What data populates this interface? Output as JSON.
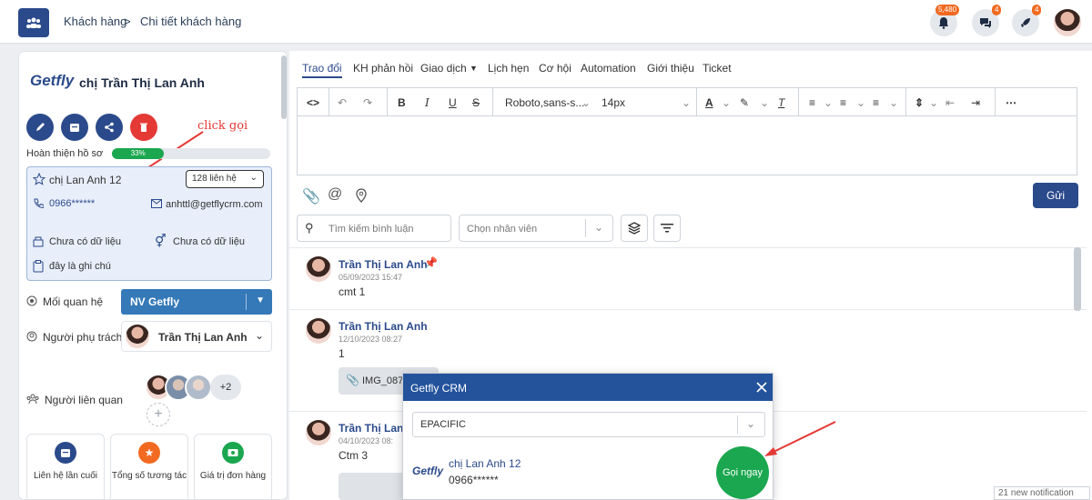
{
  "topbar": {
    "breadcrumb_1": "Khách hàng",
    "breadcrumb_sep": ">",
    "breadcrumb_2": "Chi tiết khách hàng",
    "notif_count": "5,480",
    "chat_count": "4",
    "rocket_count": "4"
  },
  "customer": {
    "logo": "Getfly",
    "name": "chị Trần Thị Lan Anh",
    "progress_label": "Hoàn thiện hồ sơ",
    "progress_value": "33%",
    "progress_fraction": 0.33
  },
  "annotations": {
    "click_call": "click gọi"
  },
  "contact": {
    "name": "chị Lan Anh 12",
    "count_label": "128 liên hệ",
    "phone": "0966******",
    "email": "anhttl@getflycrm.com",
    "field_1": "Chưa có dữ liệu",
    "field_2": "Chưa có dữ liệu",
    "note": "đây là ghi chú"
  },
  "relation": {
    "label": "Mối quan hệ",
    "value": "NV Getfly"
  },
  "owner": {
    "label": "Người phụ trách",
    "name": "Trần Thị Lan Anh"
  },
  "related": {
    "label": "Người liên quan",
    "more": "+2",
    "add": "+"
  },
  "tiles": [
    {
      "label": "Liên hệ lần cuối"
    },
    {
      "label": "Tổng số tương tác"
    },
    {
      "label": "Giá trị đơn hàng"
    }
  ],
  "tabs": [
    "Trao đổi",
    "KH phản hồi",
    "Giao dịch",
    "Lịch hẹn",
    "Cơ hội",
    "Automation",
    "Giới thiệu",
    "Ticket"
  ],
  "toolbar": {
    "font": "Roboto,sans-s...",
    "size": "14px"
  },
  "send_label": "Gửi",
  "search": {
    "placeholder": "Tìm kiếm bình luận",
    "staff_placeholder": "Chọn nhân viên"
  },
  "comments": [
    {
      "author": "Trần Thị Lan Anh",
      "time": "05/09/2023 15:47",
      "text": "cmt 1"
    },
    {
      "author": "Trần Thị Lan Anh",
      "time": "12/10/2023 08:27",
      "text": "1",
      "attachment": "IMG_087"
    },
    {
      "author": "Trần Thị Lan A",
      "time": "04/10/2023 08:",
      "text": "Ctm 3"
    }
  ],
  "modal": {
    "title": "Getfly CRM",
    "select_value": "EPACIFIC",
    "logo": "Getfly",
    "contact_name": "chị Lan Anh 12",
    "contact_phone": "0966******",
    "call_label": "Gọi ngay"
  },
  "new_notifications": "21 new notification",
  "colors": {
    "primary": "#2b4a8b",
    "green": "#1ba74f",
    "danger": "#e53935",
    "accent": "#f26a21"
  }
}
